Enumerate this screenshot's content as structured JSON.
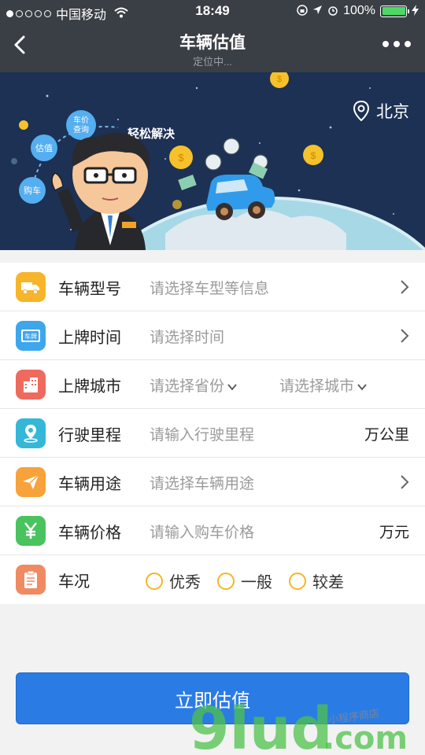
{
  "status_bar": {
    "carrier": "中国移动",
    "time": "18:49",
    "battery": "100%",
    "battery_level": 1.0
  },
  "nav": {
    "title": "车辆估值",
    "subtitle": "定位中..."
  },
  "banner": {
    "city": "北京",
    "bubbles": [
      "车价查询",
      "估值",
      "购车"
    ],
    "slogan": "轻松解决"
  },
  "form": {
    "rows": [
      {
        "label": "车辆型号",
        "placeholder": "请选择车型等信息",
        "icon": "truck-icon",
        "color": "#f6b52a"
      },
      {
        "label": "上牌时间",
        "placeholder": "请选择时间",
        "icon": "license-plate-icon",
        "color": "#3da6ec",
        "badge": "车牌"
      },
      {
        "label": "上牌城市",
        "placeholder_province": "请选择省份",
        "placeholder_city": "请选择城市",
        "icon": "building-icon",
        "color": "#ef6a5e"
      },
      {
        "label": "行驶里程",
        "placeholder": "请输入行驶里程",
        "unit": "万公里",
        "icon": "map-pin-icon",
        "color": "#35b7d8"
      },
      {
        "label": "车辆用途",
        "placeholder": "请选择车辆用途",
        "icon": "paper-plane-icon",
        "color": "#f7a23b"
      },
      {
        "label": "车辆价格",
        "placeholder": "请输入购车价格",
        "unit": "万元",
        "icon": "yuan-icon",
        "color": "#49c35e"
      },
      {
        "label": "车况",
        "options": [
          "优秀",
          "一般",
          "较差"
        ],
        "icon": "clipboard-icon",
        "color": "#f08a63"
      }
    ]
  },
  "submit_label": "立即估值",
  "watermark": {
    "brand": "9lud",
    "suffix": ".com",
    "tagline": "小程序商店"
  }
}
